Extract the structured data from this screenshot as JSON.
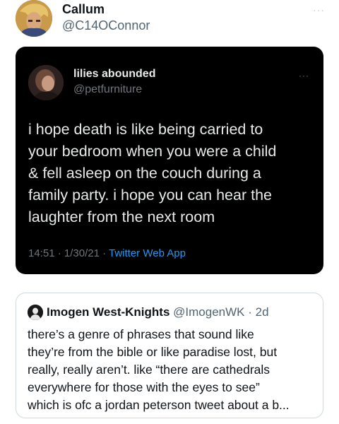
{
  "tweet": {
    "author_name": "Callum",
    "author_handle": "@C14OConnor",
    "more_icon": "ellipsis-icon"
  },
  "embedded_tweet": {
    "author_name": "lilies abounded",
    "author_handle": "@petfurniture",
    "text": "i hope death is like being carried to\nyour bedroom when you were a child\n& fell asleep on the couch during a\nfamily party. i hope you can hear the\nlaughter from the next room",
    "time": "14:51",
    "sep1": " · ",
    "date": "1/30/21",
    "sep2": " · ",
    "app": "Twitter Web App",
    "more_icon": "ellipsis-icon"
  },
  "quote_tweet": {
    "author_name": "Imogen West-Knights",
    "author_handle": "@ImogenWK",
    "sep": " · ",
    "age": "2d",
    "text": "there’s a genre of phrases that sound like\nthey’re from the bible or like paradise lost, but\nreally, really aren’t. like “there are cathedrals\neverywhere for those with the eyes to see”\nwhich is ofc a jordan peterson tweet about a b..."
  }
}
